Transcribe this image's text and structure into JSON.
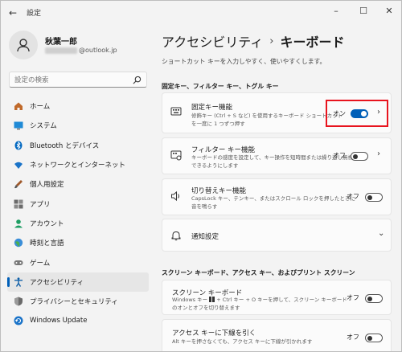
{
  "app": {
    "title": "設定",
    "back_icon": "back-arrow-icon"
  },
  "window_controls": {
    "minimize": "–",
    "maximize": "☐",
    "close": "✕"
  },
  "user": {
    "name": "秋葉一郎",
    "email_suffix": "@outlook.jp"
  },
  "search": {
    "placeholder": "設定の検索"
  },
  "nav": {
    "items": [
      {
        "label": "ホーム",
        "icon": "home-icon"
      },
      {
        "label": "システム",
        "icon": "system-icon"
      },
      {
        "label": "Bluetooth とデバイス",
        "icon": "bluetooth-icon"
      },
      {
        "label": "ネットワークとインターネット",
        "icon": "wifi-icon"
      },
      {
        "label": "個人用設定",
        "icon": "brush-icon"
      },
      {
        "label": "アプリ",
        "icon": "apps-icon"
      },
      {
        "label": "アカウント",
        "icon": "account-icon"
      },
      {
        "label": "時刻と言語",
        "icon": "globe-clock-icon"
      },
      {
        "label": "ゲーム",
        "icon": "game-icon"
      },
      {
        "label": "アクセシビリティ",
        "icon": "accessibility-icon",
        "active": true
      },
      {
        "label": "プライバシーとセキュリティ",
        "icon": "shield-icon"
      },
      {
        "label": "Windows Update",
        "icon": "update-icon"
      }
    ]
  },
  "main": {
    "breadcrumb_parent": "アクセシビリティ",
    "breadcrumb_sep": "›",
    "breadcrumb_current": "キーボード",
    "description": "ショートカット キーを入力しやすく、使いやすくします。",
    "section1_title": "固定キー、フィルター キー、トグル キー",
    "section2_title": "スクリーン キーボード、アクセス キー、およびプリント スクリーン",
    "cards": {
      "sticky": {
        "title": "固定キー機能",
        "desc": "修飾キー (Ctrl + S など) を使用するキーボード ショートカットを一度に 1 つずつ押す",
        "state": "オン"
      },
      "filter": {
        "title": "フィルター キー機能",
        "desc": "キーボードの感度を設定して、キー操作を短時間または繰り返し無視できるようにします",
        "state": "オフ"
      },
      "toggle": {
        "title": "切り替えキー機能",
        "desc": "CapsLock キー、テンキー、またはスクロール ロックを押したときに音を鳴らす",
        "state": "オフ"
      },
      "notify": {
        "title": "通知設定"
      },
      "osk": {
        "title": "スクリーン キーボード",
        "desc_a": "Windows キー",
        "desc_b": "+ Ctrl キー + O キーを押して、スクリーン キーボードのオンとオフを切り替えます",
        "state": "オフ"
      },
      "access": {
        "title": "アクセス キーに下線を引く",
        "desc": "Alt キーを押さなくても、アクセス キーに下線が引かれます",
        "state": "オフ"
      }
    }
  },
  "colors": {
    "accent": "#005fb8",
    "highlight": "#e8141e"
  }
}
